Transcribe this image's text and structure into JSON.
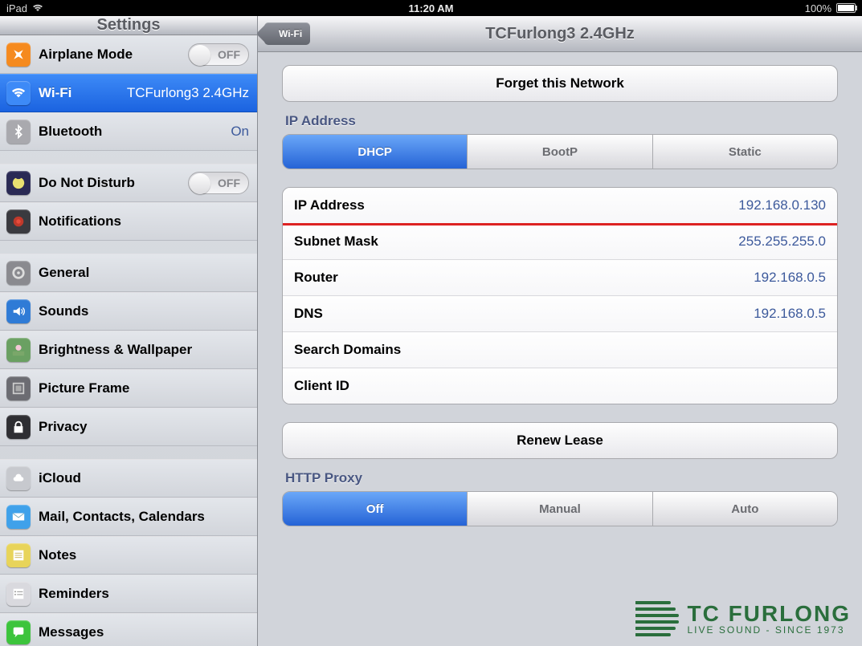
{
  "statusbar": {
    "device": "iPad",
    "time": "11:20 AM",
    "battery_pct": "100%"
  },
  "sidebar": {
    "title": "Settings",
    "groups": [
      [
        {
          "icon": "airplane",
          "label": "Airplane Mode",
          "toggle": "OFF"
        },
        {
          "icon": "wifi",
          "label": "Wi-Fi",
          "value": "TCFurlong3 2.4GHz",
          "selected": true
        },
        {
          "icon": "bluetooth",
          "label": "Bluetooth",
          "value": "On"
        }
      ],
      [
        {
          "icon": "dnd",
          "label": "Do Not Disturb",
          "toggle": "OFF"
        },
        {
          "icon": "notifications",
          "label": "Notifications"
        }
      ],
      [
        {
          "icon": "general",
          "label": "General"
        },
        {
          "icon": "sounds",
          "label": "Sounds"
        },
        {
          "icon": "brightness",
          "label": "Brightness & Wallpaper"
        },
        {
          "icon": "pictureframe",
          "label": "Picture Frame"
        },
        {
          "icon": "privacy",
          "label": "Privacy"
        }
      ],
      [
        {
          "icon": "icloud",
          "label": "iCloud"
        },
        {
          "icon": "mail",
          "label": "Mail, Contacts, Calendars"
        },
        {
          "icon": "notes",
          "label": "Notes"
        },
        {
          "icon": "reminders",
          "label": "Reminders"
        },
        {
          "icon": "messages",
          "label": "Messages"
        }
      ]
    ]
  },
  "detail": {
    "back": "Wi-Fi",
    "title": "TCFurlong3 2.4GHz",
    "forget": "Forget this Network",
    "ip_section_label": "IP Address",
    "ip_tabs": [
      "DHCP",
      "BootP",
      "Static"
    ],
    "ip_tab_active": 0,
    "ip_rows": [
      {
        "key": "IP Address",
        "value": "192.168.0.130",
        "highlight": true
      },
      {
        "key": "Subnet Mask",
        "value": "255.255.255.0"
      },
      {
        "key": "Router",
        "value": "192.168.0.5"
      },
      {
        "key": "DNS",
        "value": "192.168.0.5"
      },
      {
        "key": "Search Domains",
        "value": ""
      },
      {
        "key": "Client ID",
        "value": ""
      }
    ],
    "renew": "Renew Lease",
    "proxy_label": "HTTP Proxy",
    "proxy_tabs": [
      "Off",
      "Manual",
      "Auto"
    ],
    "proxy_tab_active": 0
  },
  "watermark": {
    "name": "TC FURLONG",
    "tagline": "LIVE SOUND - SINCE 1973"
  },
  "icon_colors": {
    "airplane": "#f58a1f",
    "wifi": "#3d8af7",
    "bluetooth": "#a9a9ae",
    "dnd": "#2a2a55",
    "notifications": "#3a3a3f",
    "general": "#8a8a8f",
    "sounds": "#2f7bd6",
    "brightness": "#6aa062",
    "pictureframe": "#6c6c72",
    "privacy": "#2f2f33",
    "icloud": "#c7c9ce",
    "mail": "#3fa1ea",
    "notes": "#e8d45a",
    "reminders": "#d9d9de",
    "messages": "#3cc43c"
  }
}
